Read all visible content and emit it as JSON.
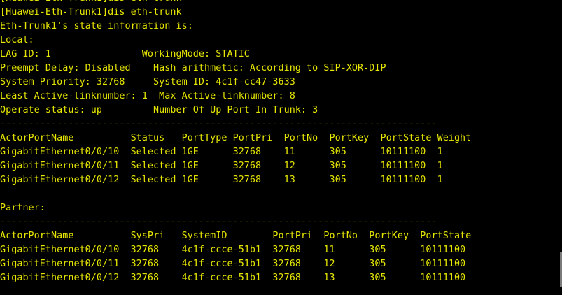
{
  "terminal": {
    "text_color": "#e6e600",
    "background": "#000000",
    "lines": [
      "[Huawei-Eth-Trunk1]dis eth-trunk",
      "[Huawei-Eth-Trunk1]dis eth-trunk",
      "Eth-Trunk1's state information is:",
      "Local:",
      "LAG ID: 1                WorkingMode: STATIC",
      "Preempt Delay: Disabled    Hash arithmetic: According to SIP-XOR-DIP",
      "System Priority: 32768     System ID: 4c1f-cc47-3633",
      "Least Active-linknumber: 1  Max Active-linknumber: 8",
      "Operate status: up         Number Of Up Port In Trunk: 3",
      "-----------------------------------------------------------------------------",
      "ActorPortName          Status   PortType PortPri  PortNo  PortKey  PortState Weight",
      "GigabitEthernet0/0/10  Selected 1GE      32768    11      305      10111100  1",
      "GigabitEthernet0/0/11  Selected 1GE      32768    12      305      10111100  1",
      "GigabitEthernet0/0/12  Selected 1GE      32768    13      305      10111100  1",
      "",
      "Partner:",
      "-----------------------------------------------------------------------------",
      "ActorPortName          SysPri   SystemID        PortPri  PortNo  PortKey  PortState",
      "GigabitEthernet0/0/10  32768    4c1f-ccce-51b1  32768    11      305      10111100",
      "GigabitEthernet0/0/11  32768    4c1f-ccce-51b1  32768    12      305      10111100",
      "GigabitEthernet0/0/12  32768    4c1f-ccce-51b1  32768    13      305      10111100"
    ]
  }
}
